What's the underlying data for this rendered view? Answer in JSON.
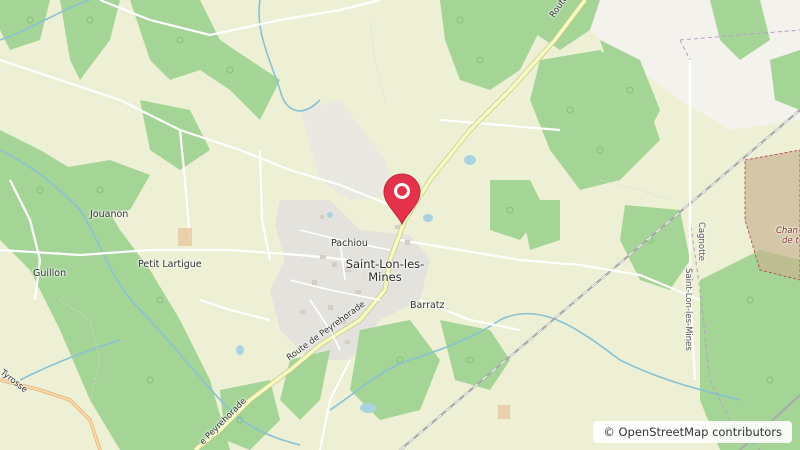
{
  "map": {
    "places": {
      "jouanon": "Jouanon",
      "guillon": "Guillon",
      "petit_lartigue": "Petit Lartigue",
      "pachiou": "Pachiou",
      "town": "Saint-Lon-les-Mines",
      "barratz": "Barratz"
    },
    "roads": {
      "route_top": "Route de",
      "route_peyrehorade": "Route de Peyrehorade",
      "route_peyrehorade_sw": "e Peyrehorade",
      "route_tyrosse": "e Tyrosse",
      "cagnotte": "Cagnotte",
      "saint_lon_vertical": "Saint-Lon-les-Mines"
    },
    "features": {
      "forest_label_line1": "Chan",
      "forest_label_line2": "de t"
    },
    "marker": {
      "icon": "map-pin-icon",
      "color": "#e3324a"
    },
    "attribution": "© OpenStreetMap contributors",
    "colors": {
      "background": "#eef0d5",
      "forest": "#a4d596",
      "residential": "#e4e2dc",
      "water": "#a9d3de",
      "main_road": "#f7fabf",
      "secondary_road": "#fcd6a4"
    }
  }
}
